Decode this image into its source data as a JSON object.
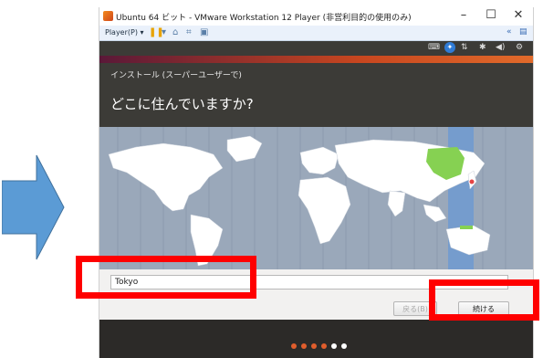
{
  "vm": {
    "title": "Ubuntu 64 ビット - VMware Workstation 12 Player (非営利目的の使用のみ)",
    "player_menu": "Player(P) ▾",
    "min": "–",
    "max": "☐",
    "close": "✕"
  },
  "installer": {
    "window_title": "インストール (スーパーユーザーで)",
    "question": "どこに住んでいますか?",
    "timezone_value": "Tokyo",
    "back_label": "戻る(B)",
    "continue_label": "続ける"
  },
  "progress": {
    "total_steps": 6,
    "current_step": 5,
    "colors": {
      "done": "#e05d2c",
      "pending": "#ffffff"
    }
  },
  "colors": {
    "highlight": "#ff0000",
    "arrow": "#5b9bd5",
    "land": "#ffffff",
    "selected_zone": "#86d152",
    "ocean": "#9aa8ba",
    "timezone_band": "#6f9ad0"
  }
}
